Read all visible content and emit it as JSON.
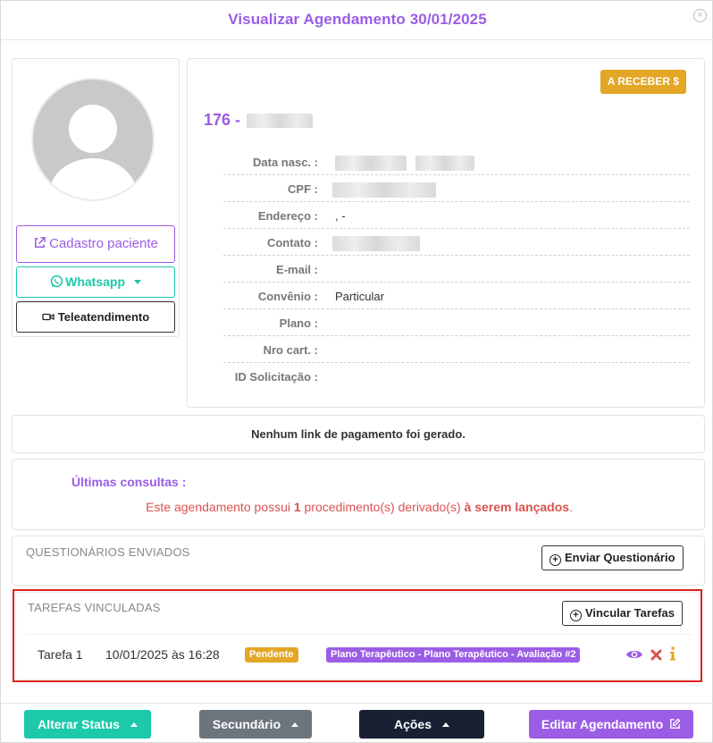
{
  "modal": {
    "title": "Visualizar Agendamento 30/01/2025",
    "close_symbol": "×"
  },
  "left_panel": {
    "cadastro_label": "Cadastro paciente",
    "whatsapp_label": "Whatsapp",
    "tele_label": "Teleatendimento"
  },
  "patient": {
    "status_badge": "A RECEBER $",
    "id_prefix": "176 -",
    "fields": [
      {
        "label": "Data nasc. :",
        "value": ""
      },
      {
        "label": "CPF :",
        "value": ""
      },
      {
        "label": "Endereço :",
        "value": ", -"
      },
      {
        "label": "Contato :",
        "value": ""
      },
      {
        "label": "E-mail :",
        "value": ""
      },
      {
        "label": "Convênio :",
        "value": "Particular"
      },
      {
        "label": "Plano :",
        "value": ""
      },
      {
        "label": "Nro cart. :",
        "value": ""
      },
      {
        "label": "ID Solicitação :",
        "value": ""
      }
    ]
  },
  "payment": {
    "message": "Nenhum link de pagamento foi gerado."
  },
  "consultas": {
    "title": "Últimas consultas :",
    "notice_prefix": "Este agendamento possui",
    "notice_count": "1",
    "notice_middle": "procedimento(s) derivado(s)",
    "notice_strong": "à serem lançados",
    "notice_end": "."
  },
  "questionarios": {
    "title": "QUESTIONÁRIOS ENVIADOS",
    "button_label": "Enviar Questionário"
  },
  "tarefas": {
    "title": "TAREFAS VINCULADAS",
    "button_label": "Vincular Tarefas",
    "items": [
      {
        "name": "Tarefa 1",
        "datetime": "10/01/2025 às 16:28",
        "status": "Pendente",
        "plan": "Plano Terapêutico - Plano Terapêutico - Avaliação #2"
      }
    ]
  },
  "footer": {
    "alterar_status": "Alterar Status",
    "secundario": "Secundário",
    "acoes": "Ações",
    "editar": "Editar Agendamento"
  },
  "colors": {
    "accent_purple": "#9b5de5",
    "teal": "#1ccaa9",
    "badge_orange": "#e3a625",
    "alert_red": "#d9534f",
    "highlight_border": "#e02020"
  }
}
